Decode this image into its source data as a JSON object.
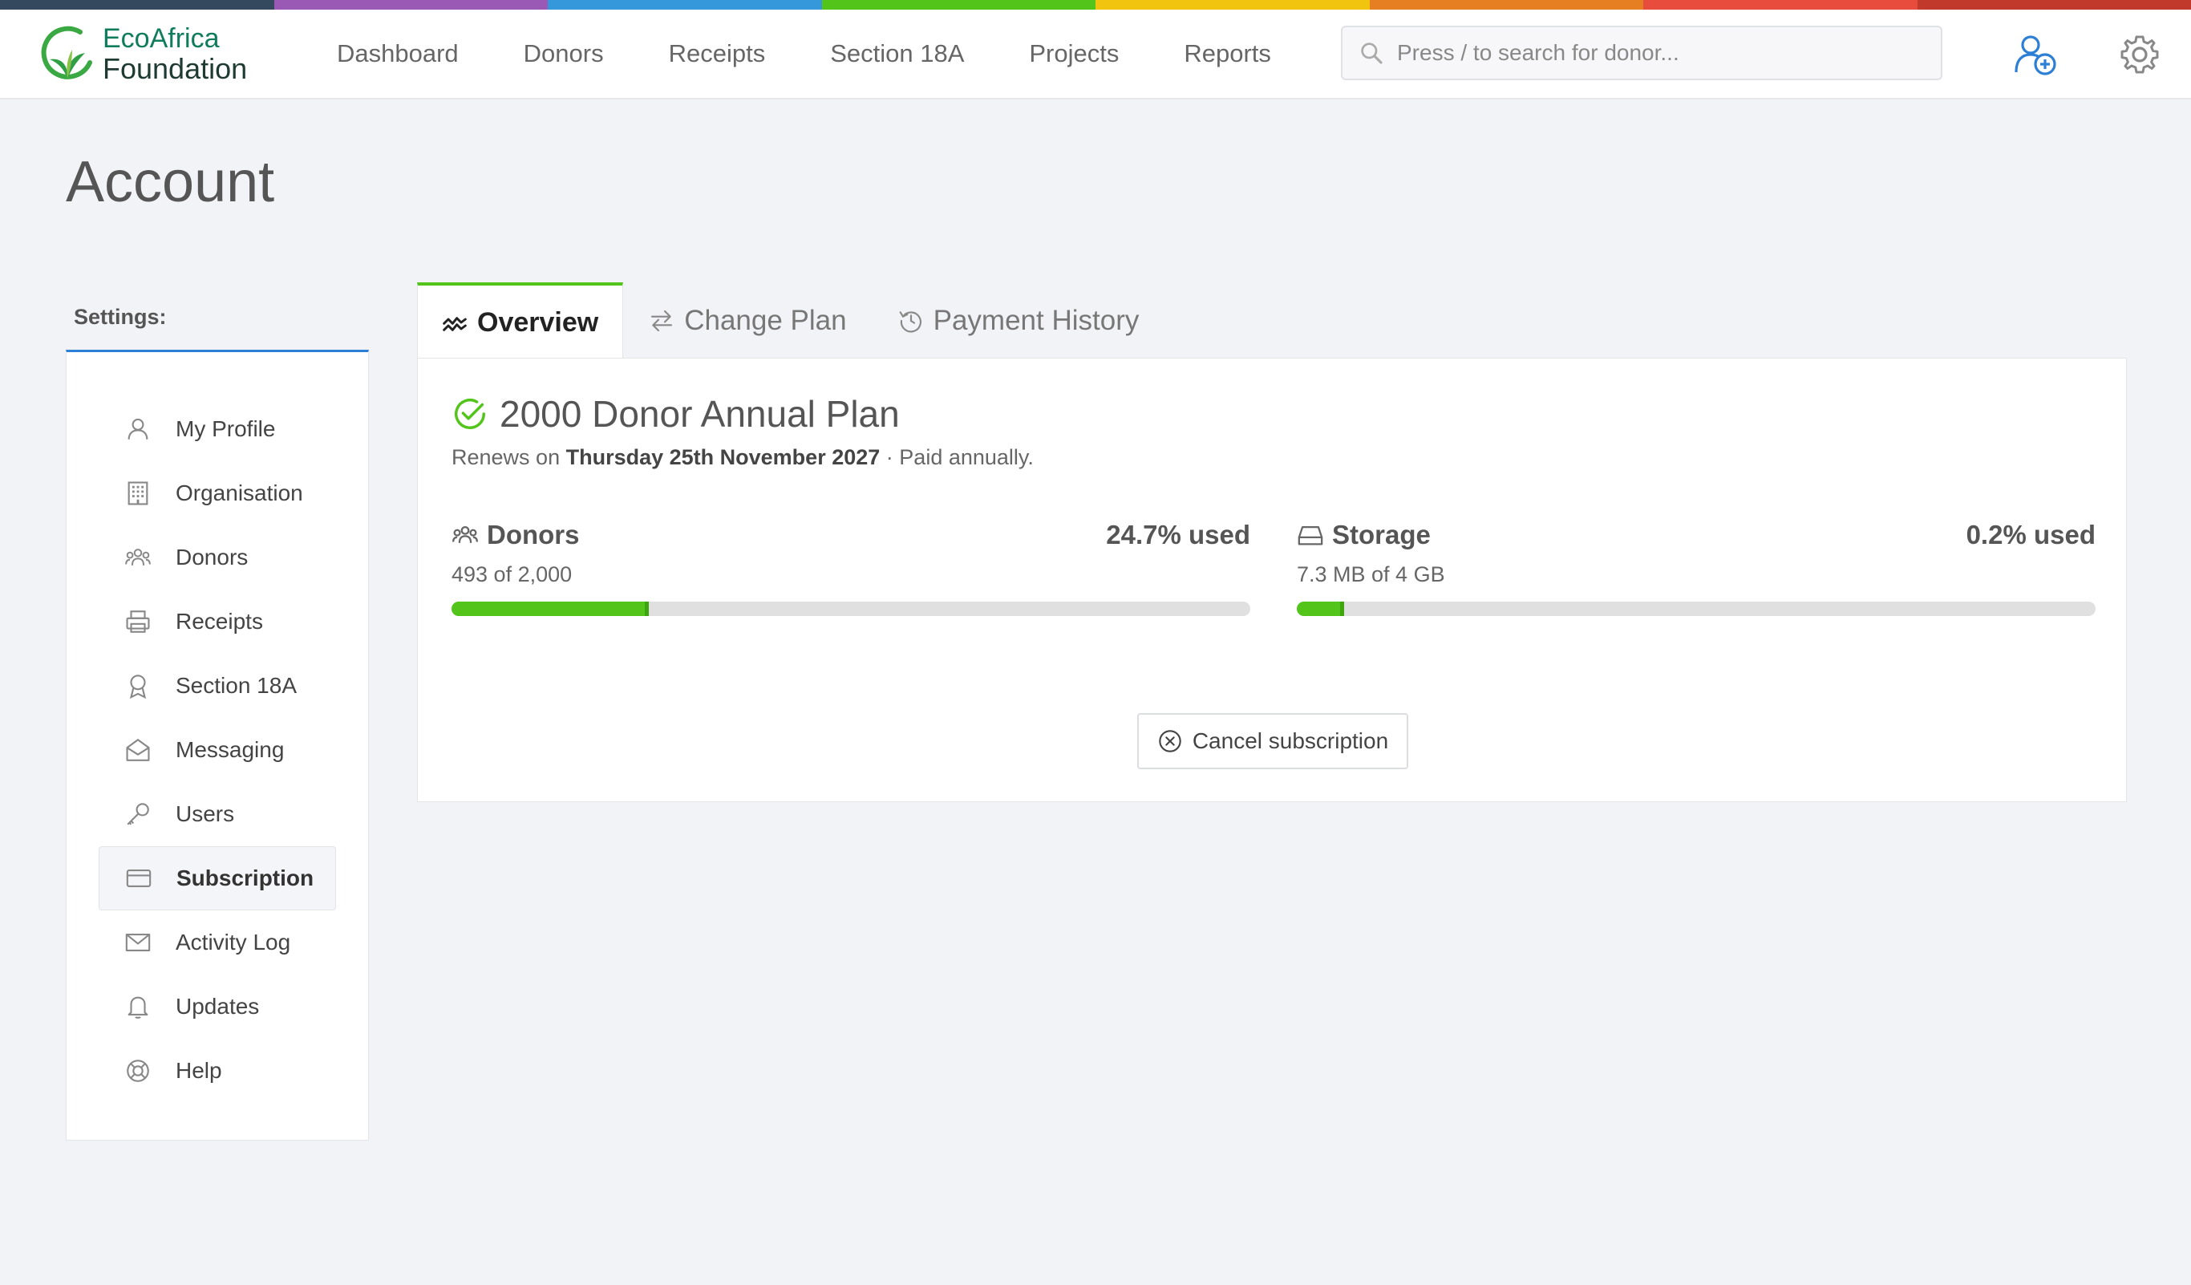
{
  "brand": {
    "line1": "EcoAfrica",
    "line2": "Foundation",
    "rainbow": [
      "#34495e",
      "#9b59b6",
      "#3498db",
      "#52c41a",
      "#f1c40f",
      "#e67e22",
      "#e74c3c",
      "#c0392b"
    ]
  },
  "nav": {
    "links": [
      "Dashboard",
      "Donors",
      "Receipts",
      "Section 18A",
      "Projects",
      "Reports"
    ],
    "search_placeholder": "Press / to search for donor...",
    "add_user_icon": "add-user-icon",
    "settings_icon": "gear-icon"
  },
  "page": {
    "title": "Account"
  },
  "sidebar": {
    "label": "Settings:",
    "items": [
      {
        "label": "My Profile",
        "icon": "user-icon"
      },
      {
        "label": "Organisation",
        "icon": "building-icon"
      },
      {
        "label": "Donors",
        "icon": "users-icon"
      },
      {
        "label": "Receipts",
        "icon": "printer-icon"
      },
      {
        "label": "Section 18A",
        "icon": "award-icon"
      },
      {
        "label": "Messaging",
        "icon": "envelope-open-icon"
      },
      {
        "label": "Users",
        "icon": "key-icon"
      },
      {
        "label": "Subscription",
        "icon": "credit-card-icon",
        "active": true
      },
      {
        "label": "Activity Log",
        "icon": "mail-icon"
      },
      {
        "label": "Updates",
        "icon": "bell-icon"
      },
      {
        "label": "Help",
        "icon": "lifebuoy-icon"
      }
    ]
  },
  "tabs": [
    {
      "label": "Overview",
      "icon": "pulse-icon",
      "active": true
    },
    {
      "label": "Change Plan",
      "icon": "swap-icon"
    },
    {
      "label": "Payment History",
      "icon": "history-icon"
    }
  ],
  "plan": {
    "title": "2000 Donor Annual Plan",
    "renews_prefix": "Renews on",
    "renews_date": "Thursday 25th November 2027",
    "renews_suffix": "· Paid annually.",
    "accent": "#52c41a"
  },
  "usage": {
    "donors": {
      "name": "Donors",
      "pct_label": "24.7% used",
      "detail": "493 of 2,000",
      "fraction": 0.247
    },
    "storage": {
      "name": "Storage",
      "pct_label": "0.2% used",
      "detail": "7.3 MB of 4 GB",
      "fraction": 0.059
    }
  },
  "cancel": {
    "label": "Cancel subscription"
  }
}
